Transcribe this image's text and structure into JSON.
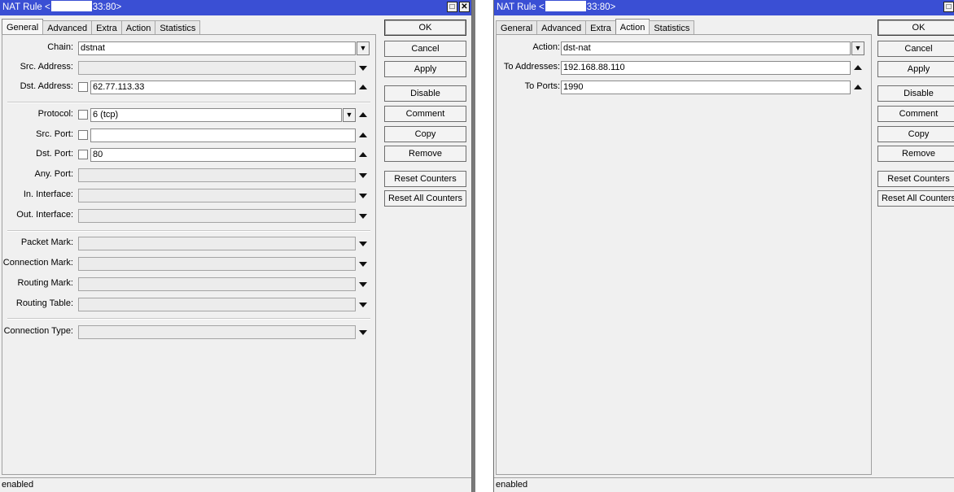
{
  "left": {
    "title_prefix": "NAT Rule <",
    "title_suffix": "33:80>",
    "tabs": [
      "General",
      "Advanced",
      "Extra",
      "Action",
      "Statistics"
    ],
    "active_tab": "General",
    "fields": {
      "chain": {
        "label": "Chain:",
        "value": "dstnat"
      },
      "src_address": {
        "label": "Src. Address:"
      },
      "dst_address": {
        "label": "Dst. Address:",
        "value": "62.77.113.33"
      },
      "protocol": {
        "label": "Protocol:",
        "value": "6 (tcp)"
      },
      "src_port": {
        "label": "Src. Port:"
      },
      "dst_port": {
        "label": "Dst. Port:",
        "value": "80"
      },
      "any_port": {
        "label": "Any. Port:"
      },
      "in_interface": {
        "label": "In. Interface:"
      },
      "out_interface": {
        "label": "Out. Interface:"
      },
      "packet_mark": {
        "label": "Packet Mark:"
      },
      "connection_mark": {
        "label": "Connection Mark:"
      },
      "routing_mark": {
        "label": "Routing Mark:"
      },
      "routing_table": {
        "label": "Routing Table:"
      },
      "connection_type": {
        "label": "Connection Type:"
      }
    },
    "buttons": {
      "ok": "OK",
      "cancel": "Cancel",
      "apply": "Apply",
      "disable": "Disable",
      "comment": "Comment",
      "copy": "Copy",
      "remove": "Remove",
      "reset_counters": "Reset Counters",
      "reset_all_counters": "Reset All Counters"
    },
    "status": "enabled"
  },
  "right": {
    "title_prefix": "NAT Rule <",
    "title_suffix": "33:80>",
    "tabs": [
      "General",
      "Advanced",
      "Extra",
      "Action",
      "Statistics"
    ],
    "active_tab": "Action",
    "fields": {
      "action": {
        "label": "Action:",
        "value": "dst-nat"
      },
      "to_addresses": {
        "label": "To Addresses:",
        "value": "192.168.88.110"
      },
      "to_ports": {
        "label": "To Ports:",
        "value": "1990"
      }
    },
    "buttons": {
      "ok": "OK",
      "cancel": "Cancel",
      "apply": "Apply",
      "disable": "Disable",
      "comment": "Comment",
      "copy": "Copy",
      "remove": "Remove",
      "reset_counters": "Reset Counters",
      "reset_all_counters": "Reset All Counters"
    },
    "status": "enabled"
  }
}
